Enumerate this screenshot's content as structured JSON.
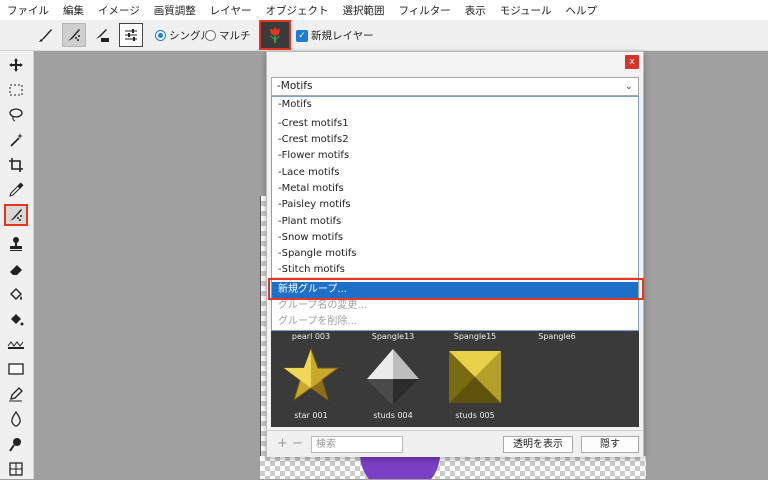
{
  "menu": [
    "ファイル",
    "編集",
    "イメージ",
    "画質調整",
    "レイヤー",
    "オブジェクト",
    "選択範囲",
    "フィルター",
    "表示",
    "モジュール",
    "ヘルプ"
  ],
  "toolbar": {
    "tools": [
      "brush-icon",
      "sparkle-brush-icon",
      "stamp-brush-icon",
      "sliders-icon"
    ],
    "radio_single": "シングル",
    "radio_multi": "マルチ",
    "motif_icon": "tulip-icon",
    "new_layer_label": "新規レイヤー"
  },
  "left_tools": [
    "move-icon",
    "rect-select-icon",
    "lasso-icon",
    "magic-wand-icon",
    "crop-icon",
    "eyedropper-icon",
    "motif-brush-icon",
    "stamp-icon",
    "eraser-icon",
    "bucket-icon",
    "gradient-bucket-icon",
    "ruler-icon",
    "rectangle-icon",
    "pen-icon",
    "drop-icon",
    "smudge-icon",
    "grid-icon"
  ],
  "panel": {
    "close_label": "x",
    "dropdown_value": "-Motifs",
    "list": [
      {
        "label": "-Motifs",
        "state": "sep"
      },
      {
        "label": "-Crest motifs1",
        "state": ""
      },
      {
        "label": "-Crest motifs2",
        "state": ""
      },
      {
        "label": "-Flower motifs",
        "state": ""
      },
      {
        "label": "-Lace motifs",
        "state": ""
      },
      {
        "label": "-Metal motifs",
        "state": ""
      },
      {
        "label": "-Paisley motifs",
        "state": ""
      },
      {
        "label": "-Plant motifs",
        "state": ""
      },
      {
        "label": "-Snow motifs",
        "state": ""
      },
      {
        "label": "-Spangle motifs",
        "state": ""
      },
      {
        "label": "-Stitch motifs",
        "state": "sep"
      },
      {
        "label": "新規グループ...",
        "state": "hl"
      },
      {
        "label": "グループ名の変更...",
        "state": "dis"
      },
      {
        "label": "グループを削除...",
        "state": "dis"
      }
    ],
    "top_captions": [
      "pearl 003",
      "Spangle13",
      "Spangle15",
      "Spangle6"
    ],
    "thumbs": [
      "star 001",
      "studs 004",
      "studs 005"
    ],
    "search_placeholder": "検索",
    "plus": "+",
    "minus": "−",
    "show_transparent": "透明を表示",
    "hide": "隠す"
  },
  "colors": {
    "highlight": "#e8361e",
    "selection": "#1e6fc8",
    "accent": "#1e7bd8"
  }
}
